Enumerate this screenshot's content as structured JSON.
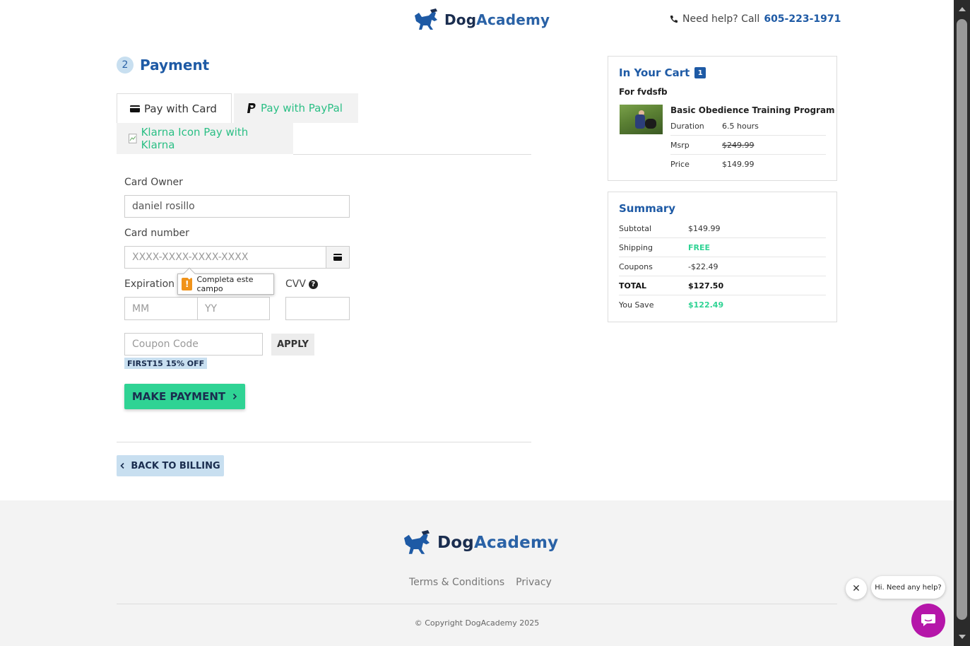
{
  "header": {
    "logo": {
      "dog": "Dog",
      "academy": "Academy"
    },
    "help_text": "Need help? Call",
    "phone": "605-223-1971"
  },
  "payment": {
    "step_number": "2",
    "title": "Payment",
    "tabs": {
      "card": "Pay with Card",
      "paypal": "Pay with PayPal",
      "klarna": "Klarna Icon Pay with Klarna"
    },
    "card_owner_label": "Card Owner",
    "card_owner_value": "daniel rosillo",
    "card_number_label": "Card number",
    "card_number_placeholder": "XXXX-XXXX-XXXX-XXXX",
    "expiration_label": "Expiration Date",
    "expiration_visible": "Expiration I",
    "mm_placeholder": "MM",
    "yy_placeholder": "YY",
    "cvv_label": "CVV",
    "cvv_help": "?",
    "tooltip_text": "Completa este campo",
    "tooltip_icon": "!",
    "coupon_placeholder": "Coupon Code",
    "apply_label": "APPLY",
    "coupon_badge": "FIRST15 15% OFF",
    "make_payment_label": "MAKE PAYMENT",
    "back_label": "BACK TO BILLING"
  },
  "cart": {
    "title": "In Your Cart",
    "count": "1",
    "for_line": "For fvdsfb",
    "product_name": "Basic Obedience Training Program",
    "rows": [
      {
        "k": "Duration",
        "v": "6.5 hours"
      },
      {
        "k": "Msrp",
        "v": "$249.99"
      },
      {
        "k": "Price",
        "v": "$149.99"
      }
    ]
  },
  "summary": {
    "title": "Summary",
    "rows": [
      {
        "k": "Subtotal",
        "v": "$149.99"
      },
      {
        "k": "Shipping",
        "v": "FREE"
      },
      {
        "k": "Coupons",
        "v": "-$22.49"
      },
      {
        "k": "TOTAL",
        "v": "$127.50"
      },
      {
        "k": "You Save",
        "v": "$122.49"
      }
    ]
  },
  "footer": {
    "logo": {
      "dog": "Dog",
      "academy": "Academy"
    },
    "links": {
      "terms": "Terms & Conditions",
      "privacy": "Privacy"
    },
    "copyright": "© Copyright DogAcademy 2025"
  },
  "chat": {
    "close": "✕",
    "bubble": "Hi. Need any help?"
  },
  "colors": {
    "brand_blue": "#1e5aa5",
    "brand_navy": "#1a2d4f",
    "accent_green": "#2fd394",
    "chat_purple": "#b516a9"
  }
}
